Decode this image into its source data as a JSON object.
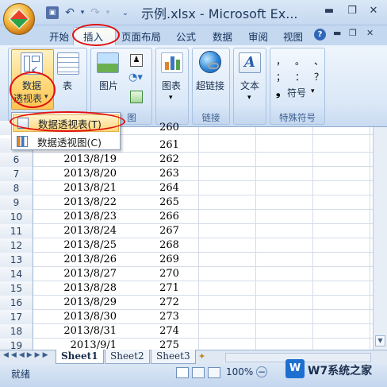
{
  "window": {
    "title": "示例.xlsx - Microsoft Ex...",
    "minimize_icon": "minimize-icon",
    "restore_icon": "restore-icon",
    "close_icon": "close-icon"
  },
  "quick_access": {
    "save_icon": "save-icon",
    "undo_icon": "undo-icon",
    "redo_icon": "redo-icon",
    "customize_icon": "chevron-down-icon"
  },
  "tabs": [
    {
      "label": "开始",
      "active": false
    },
    {
      "label": "插入",
      "active": true
    },
    {
      "label": "页面布局",
      "active": false
    },
    {
      "label": "公式",
      "active": false
    },
    {
      "label": "数据",
      "active": false
    },
    {
      "label": "审阅",
      "active": false
    },
    {
      "label": "视图",
      "active": false
    }
  ],
  "ribbon": {
    "tables_group": {
      "pivot_label_1": "数据",
      "pivot_label_2": "透视表",
      "pivot_arrow": "▾",
      "table_label": "表",
      "group_label": ""
    },
    "illustrations_group": {
      "picture_label": "图片",
      "group_label": "图"
    },
    "charts_group": {
      "chart_label": "图表",
      "chart_arrow": "▾",
      "group_label": ""
    },
    "links_group": {
      "hyperlink_label": "超链接",
      "group_label": "链接"
    },
    "text_group": {
      "text_label": "文本",
      "text_arrow": "▾",
      "group_label": ""
    },
    "special_group": {
      "symbols_row1": [
        "，",
        "。",
        "、"
      ],
      "symbols_row2": [
        "；",
        "：",
        "？"
      ],
      "symbol_label": "符号",
      "symbol_arrow": "▾",
      "group_label": "特殊符号"
    }
  },
  "dropdown": {
    "items": [
      {
        "label": "数据透视表(T)",
        "icon": "pivot-table-icon",
        "highlighted": true
      },
      {
        "label": "数据透视图(C)",
        "icon": "pivot-chart-icon",
        "highlighted": false
      }
    ]
  },
  "sheet": {
    "partial_top_value": "260",
    "first_visible_value": "261",
    "rows": [
      {
        "num": "6",
        "date": "2013/8/19",
        "value": "262"
      },
      {
        "num": "7",
        "date": "2013/8/20",
        "value": "263"
      },
      {
        "num": "8",
        "date": "2013/8/21",
        "value": "264"
      },
      {
        "num": "9",
        "date": "2013/8/22",
        "value": "265"
      },
      {
        "num": "10",
        "date": "2013/8/23",
        "value": "266"
      },
      {
        "num": "11",
        "date": "2013/8/24",
        "value": "267"
      },
      {
        "num": "12",
        "date": "2013/8/25",
        "value": "268"
      },
      {
        "num": "13",
        "date": "2013/8/26",
        "value": "269"
      },
      {
        "num": "14",
        "date": "2013/8/27",
        "value": "270"
      },
      {
        "num": "15",
        "date": "2013/8/28",
        "value": "271"
      },
      {
        "num": "16",
        "date": "2013/8/29",
        "value": "272"
      },
      {
        "num": "17",
        "date": "2013/8/30",
        "value": "273"
      },
      {
        "num": "18",
        "date": "2013/8/31",
        "value": "274"
      },
      {
        "num": "19",
        "date": "2013/9/1",
        "value": "275"
      }
    ]
  },
  "sheet_tabs": [
    "Sheet1",
    "Sheet2",
    "Sheet3"
  ],
  "status": {
    "ready": "就绪",
    "zoom": "100%",
    "zoom_out": "−",
    "watermark": "W7系统之家"
  },
  "colors": {
    "accent_red": "#e01010",
    "ribbon_blue": "#dbe8f7",
    "highlight": "#ffe7a2"
  }
}
